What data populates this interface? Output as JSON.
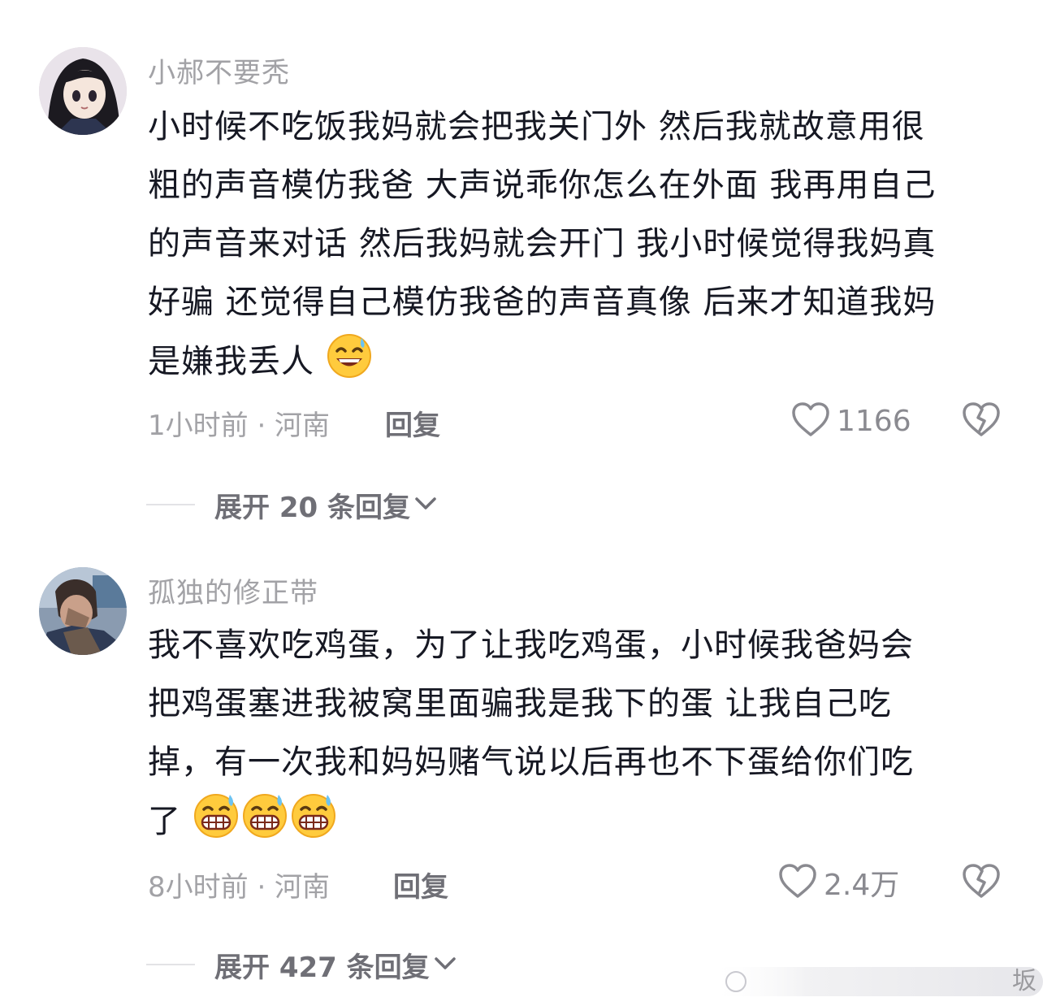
{
  "comments": [
    {
      "username": "小郝不要秃",
      "body_lines": [
        "小时候不吃饭我妈就会把我关门外 然后我就故意用很",
        "粗的声音模仿我爸 大声说乖你怎么在外面 我再用自己",
        "的声音来对话 然后我妈就会开门 我小时候觉得我妈真",
        "好骗 还觉得自己模仿我爸的声音真像 后来才知道我妈",
        "是嫌我丢人"
      ],
      "emoji": [
        "grinning-sweat-emoji"
      ],
      "time_location": "1小时前 · 河南",
      "reply_label": "回复",
      "like_count": "1166",
      "expand_label": "展开 20 条回复"
    },
    {
      "username": "孤独的修正带",
      "body_lines": [
        "我不喜欢吃鸡蛋，为了让我吃鸡蛋，小时候我爸妈会",
        "把鸡蛋塞进我被窝里面骗我是我下的蛋 让我自己吃",
        "掉，有一次我和妈妈赌气说以后再也不下蛋给你们吃",
        "了"
      ],
      "emoji": [
        "grimace-sweat-emoji",
        "grimace-sweat-emoji",
        "grimace-sweat-emoji"
      ],
      "time_location": "8小时前 · 河南",
      "reply_label": "回复",
      "like_count": "2.4万",
      "expand_label": "展开 427 条回复"
    }
  ],
  "icons": {
    "like": "heart-outline-icon",
    "dislike": "broken-heart-icon",
    "expand": "chevron-down-icon"
  },
  "watermark": {
    "text": "坂"
  },
  "colors": {
    "text_primary": "#161823",
    "text_secondary": "#a2a2a6",
    "action_text": "#6f6f76",
    "divider": "#e3e3e6"
  }
}
